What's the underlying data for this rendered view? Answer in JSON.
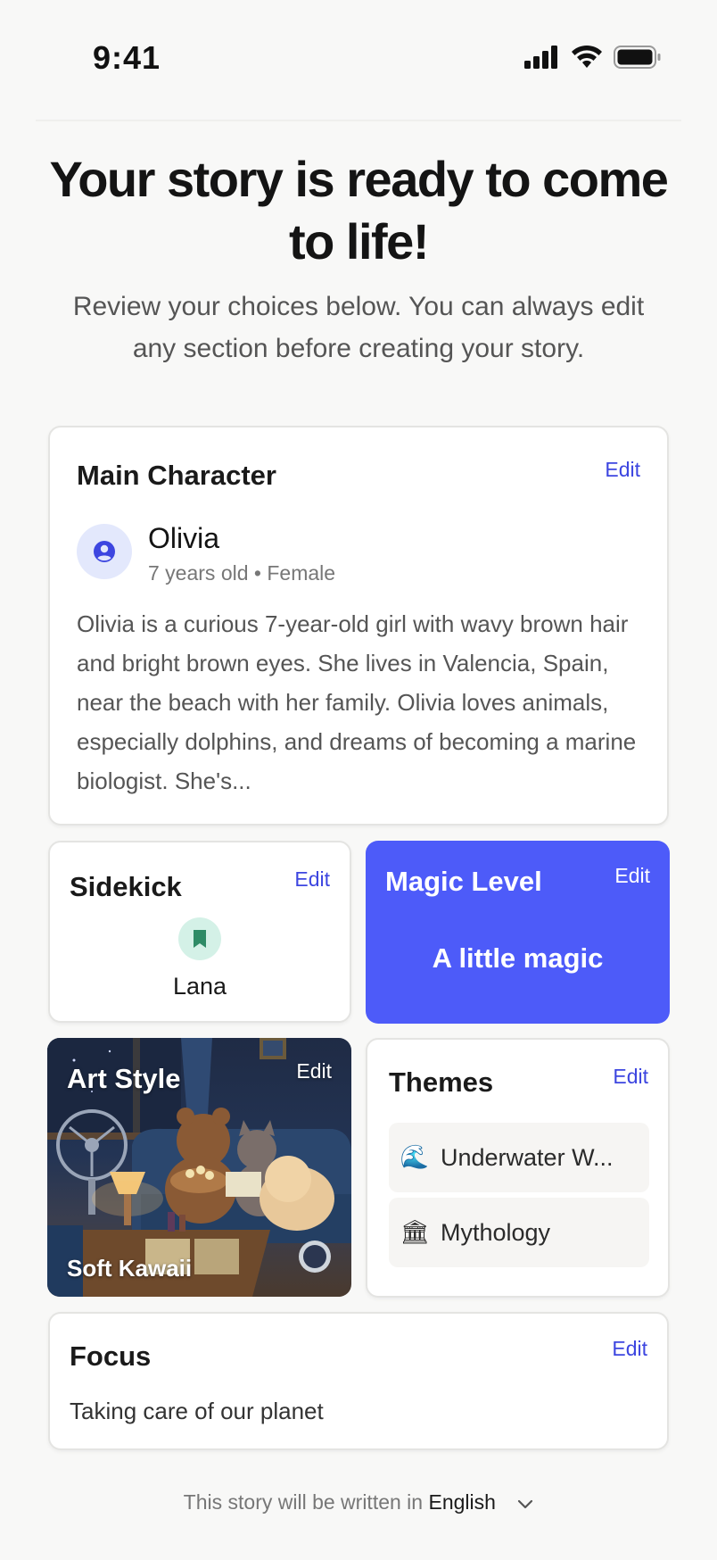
{
  "status_bar": {
    "time": "9:41"
  },
  "hero": {
    "title": "Your story is ready to come to life!",
    "subtitle": "Review your choices below. You can always edit any section before creating your story."
  },
  "edit_label": "Edit",
  "main_character": {
    "title": "Main Character",
    "name": "Olivia",
    "age": "7 years old",
    "gender": "Female",
    "separator": "•",
    "description": "Olivia is a curious 7-year-old girl with wavy brown hair and bright brown eyes. She lives in Valencia, Spain, near the beach with her family. Olivia loves animals, especially dolphins, and dreams of becoming a marine biologist. She's..."
  },
  "sidekick": {
    "title": "Sidekick",
    "name": "Lana",
    "icon": "bookmark-icon"
  },
  "magic_level": {
    "title": "Magic Level",
    "value": "A little magic",
    "background": "#4d5bf9"
  },
  "art_style": {
    "title": "Art Style",
    "value": "Soft Kawaii"
  },
  "themes": {
    "title": "Themes",
    "items": [
      {
        "emoji": "🌊",
        "label": "Underwater W..."
      },
      {
        "emoji": "🏛",
        "label": "Mythology"
      }
    ]
  },
  "focus": {
    "title": "Focus",
    "value": "Taking care of our planet"
  },
  "language": {
    "prefix": "This story will be written in",
    "value": "English"
  },
  "colors": {
    "accent": "#3d46e0",
    "magic_bg": "#4d5bf9",
    "sidekick_icon": "#2e8b66"
  }
}
